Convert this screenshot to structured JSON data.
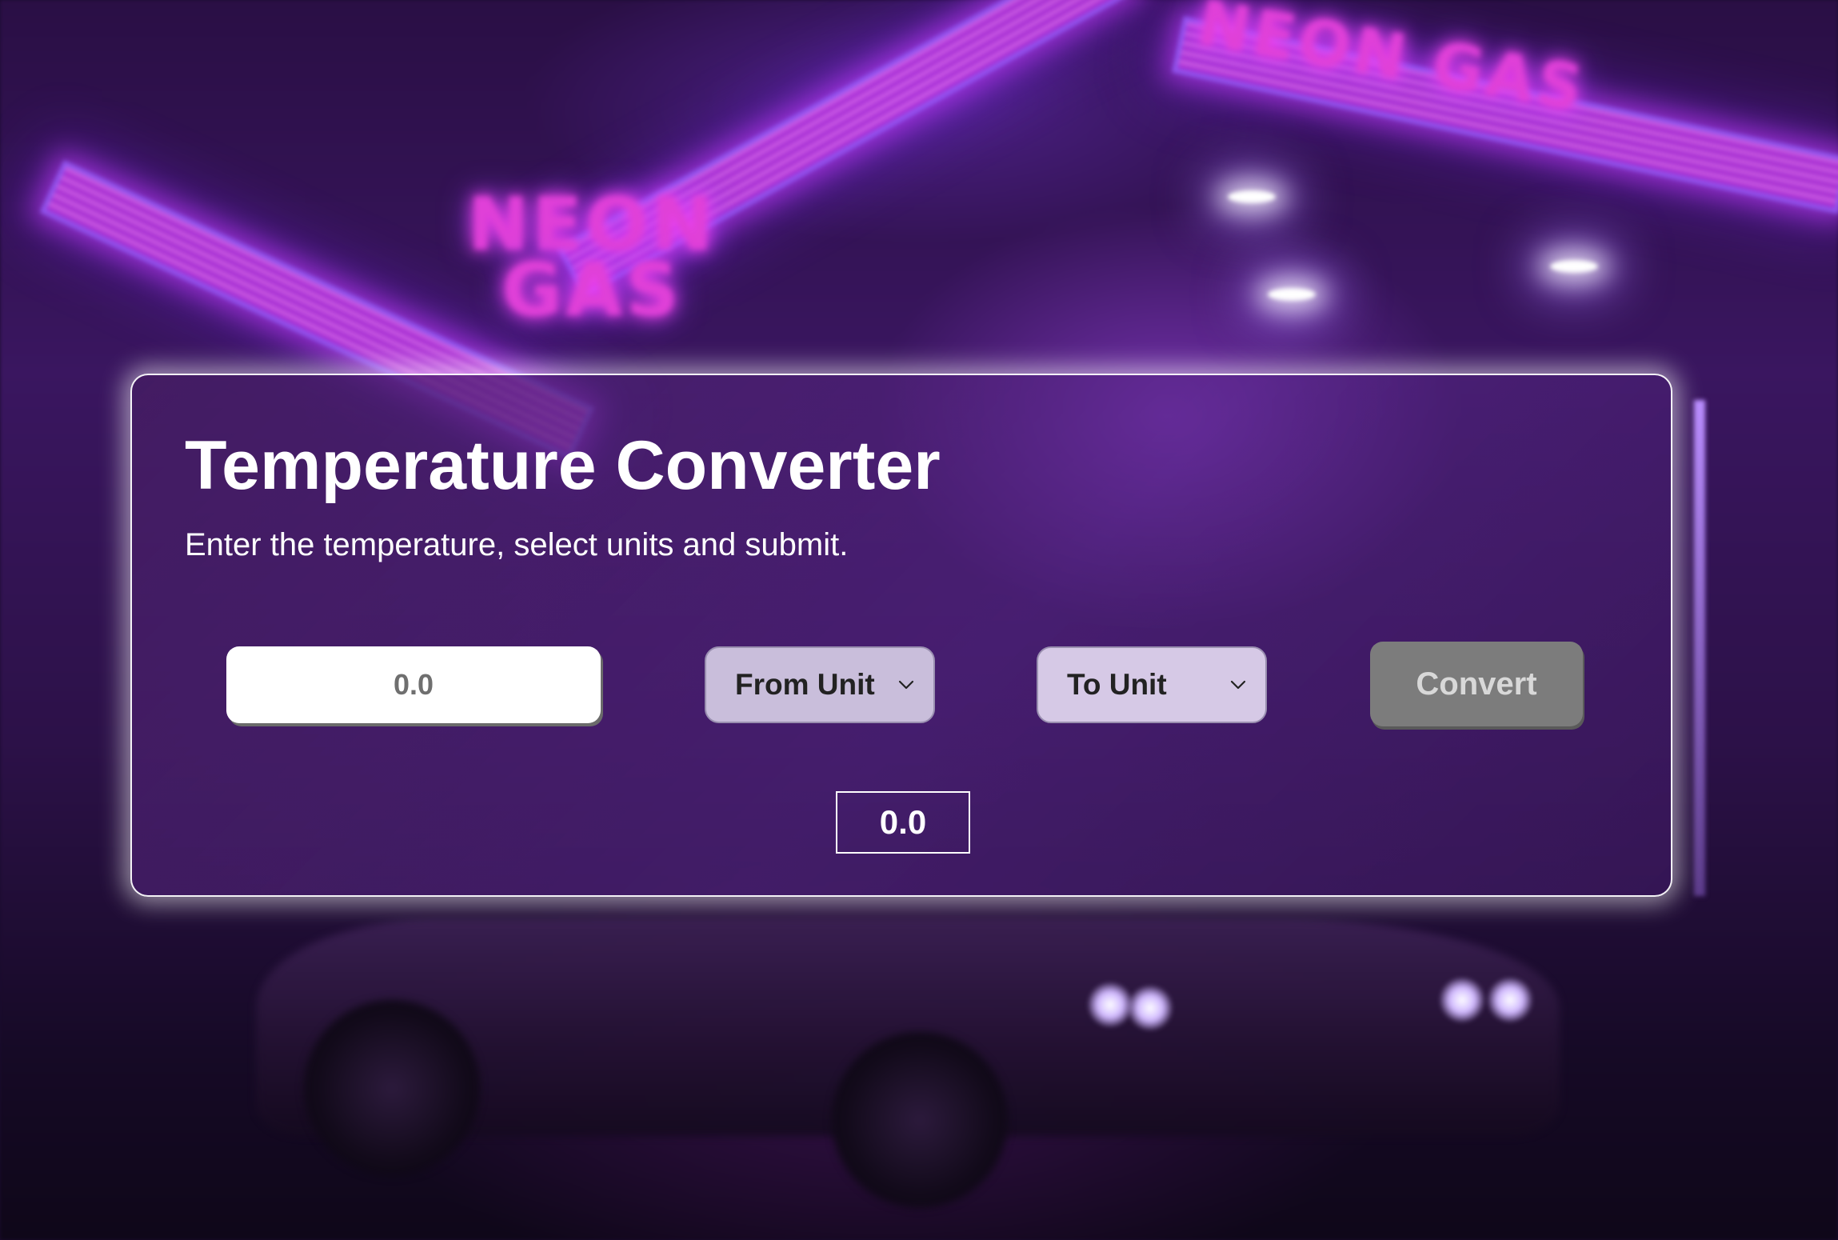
{
  "app": {
    "title": "Temperature Converter",
    "subtitle": "Enter the temperature, select units and submit."
  },
  "form": {
    "temperature_placeholder": "0.0",
    "from_unit_label": "From Unit",
    "to_unit_label": "To Unit",
    "convert_label": "Convert"
  },
  "result": {
    "value": "0.0"
  },
  "background": {
    "sign_text_main": "NEON GAS",
    "sign_text_roof": "NEON GAS"
  },
  "colors": {
    "convert_button": "#7c7c7c",
    "select_from": "#c9bedb",
    "select_to": "#d6c9e6",
    "panel_border": "#ffffff"
  },
  "icons": {
    "select_arrow": "chevron-down-icon"
  }
}
